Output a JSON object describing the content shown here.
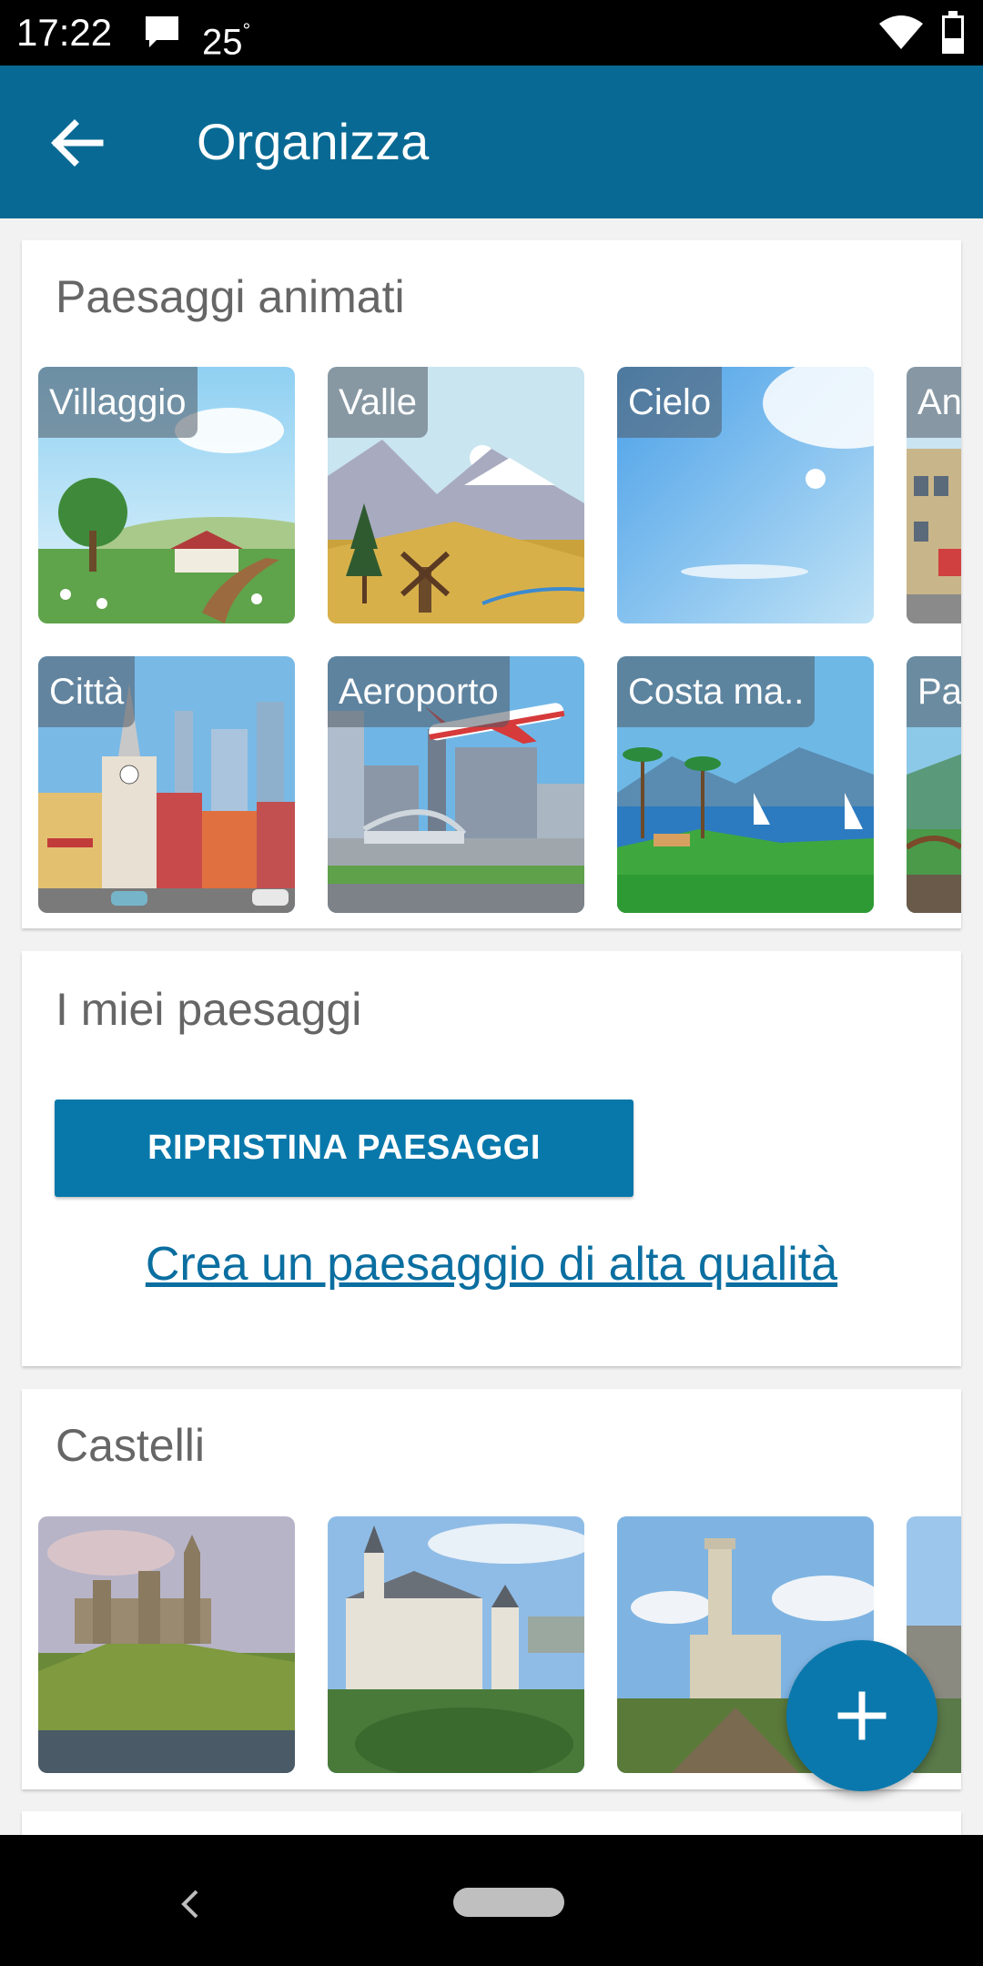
{
  "status_bar": {
    "time": "17:22",
    "temperature": "25",
    "temperature_unit": "°"
  },
  "app_bar": {
    "title": "Organizza",
    "back_icon": "arrow-left-icon"
  },
  "animated": {
    "title": "Paesaggi animati",
    "row1": [
      "Villaggio",
      "Valle",
      "Cielo",
      "An"
    ],
    "row2": [
      "Città",
      "Aeroporto",
      "Costa ma..",
      "Pa"
    ]
  },
  "my_landscapes": {
    "title": "I miei paesaggi",
    "restore_label": "RIPRISTINA PAESAGGI",
    "hq_link": "Crea un paesaggio di alta qualità"
  },
  "castles": {
    "title": "Castelli"
  },
  "fab": {
    "icon": "plus-icon"
  },
  "colors": {
    "primary": "#086a94",
    "accent": "#0878ab",
    "link": "#0a6ea0"
  }
}
